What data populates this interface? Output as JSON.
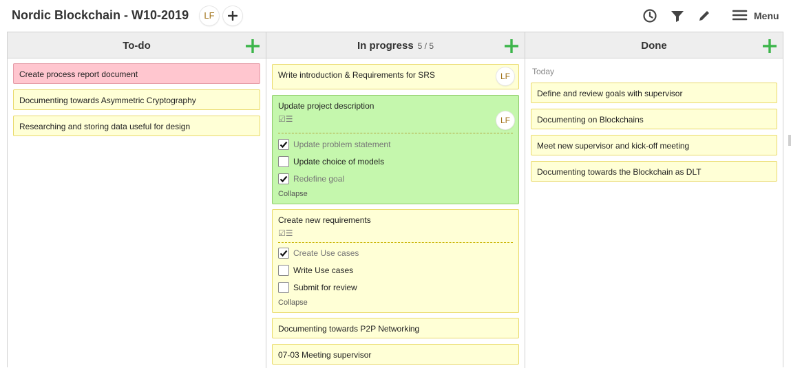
{
  "header": {
    "title": "Nordic Blockchain - W10-2019",
    "member_avatar": "LF",
    "icons": [
      "history-icon",
      "filter-icon",
      "pencil-icon",
      "hamburger-icon"
    ],
    "menu_label": "Menu"
  },
  "colors": {
    "accent_green": "#3cb54a",
    "card_yellow": "#ffffd6",
    "card_pink": "#ffc6cf",
    "card_green": "#c5f7ad",
    "avatar_text": "#a2731a"
  },
  "columns": [
    {
      "title": "To-do",
      "cards": [
        {
          "title": "Create process report document",
          "color": "pink"
        },
        {
          "title": "Documenting towards Asymmetric Cryptography",
          "color": "yellow"
        },
        {
          "title": "Researching and storing data useful for design",
          "color": "yellow"
        }
      ]
    },
    {
      "title": "In progress",
      "count": "5 / 5",
      "cards": [
        {
          "title": "Write introduction & Requirements for SRS",
          "color": "yellow",
          "avatar": "LF"
        },
        {
          "title": "Update project description",
          "color": "green",
          "avatar": "LF",
          "checklist": [
            {
              "label": "Update problem statement",
              "checked": true
            },
            {
              "label": "Update choice of models",
              "checked": false
            },
            {
              "label": "Redefine goal",
              "checked": true
            }
          ],
          "collapse_label": "Collapse"
        },
        {
          "title": "Create new requirements",
          "color": "yellow",
          "checklist": [
            {
              "label": "Create Use cases",
              "checked": true
            },
            {
              "label": "Write Use cases",
              "checked": false
            },
            {
              "label": "Submit for review",
              "checked": false
            }
          ],
          "collapse_label": "Collapse"
        },
        {
          "title": "Documenting towards P2P Networking",
          "color": "yellow"
        },
        {
          "title": "07-03 Meeting supervisor",
          "color": "yellow"
        }
      ]
    },
    {
      "title": "Done",
      "group_label": "Today",
      "cards": [
        {
          "title": "Define and review goals with supervisor",
          "color": "yellow"
        },
        {
          "title": "Documenting on Blockchains",
          "color": "yellow"
        },
        {
          "title": "Meet new supervisor and kick-off meeting",
          "color": "yellow"
        },
        {
          "title": "Documenting towards the Blockchain as DLT",
          "color": "yellow"
        }
      ]
    }
  ]
}
